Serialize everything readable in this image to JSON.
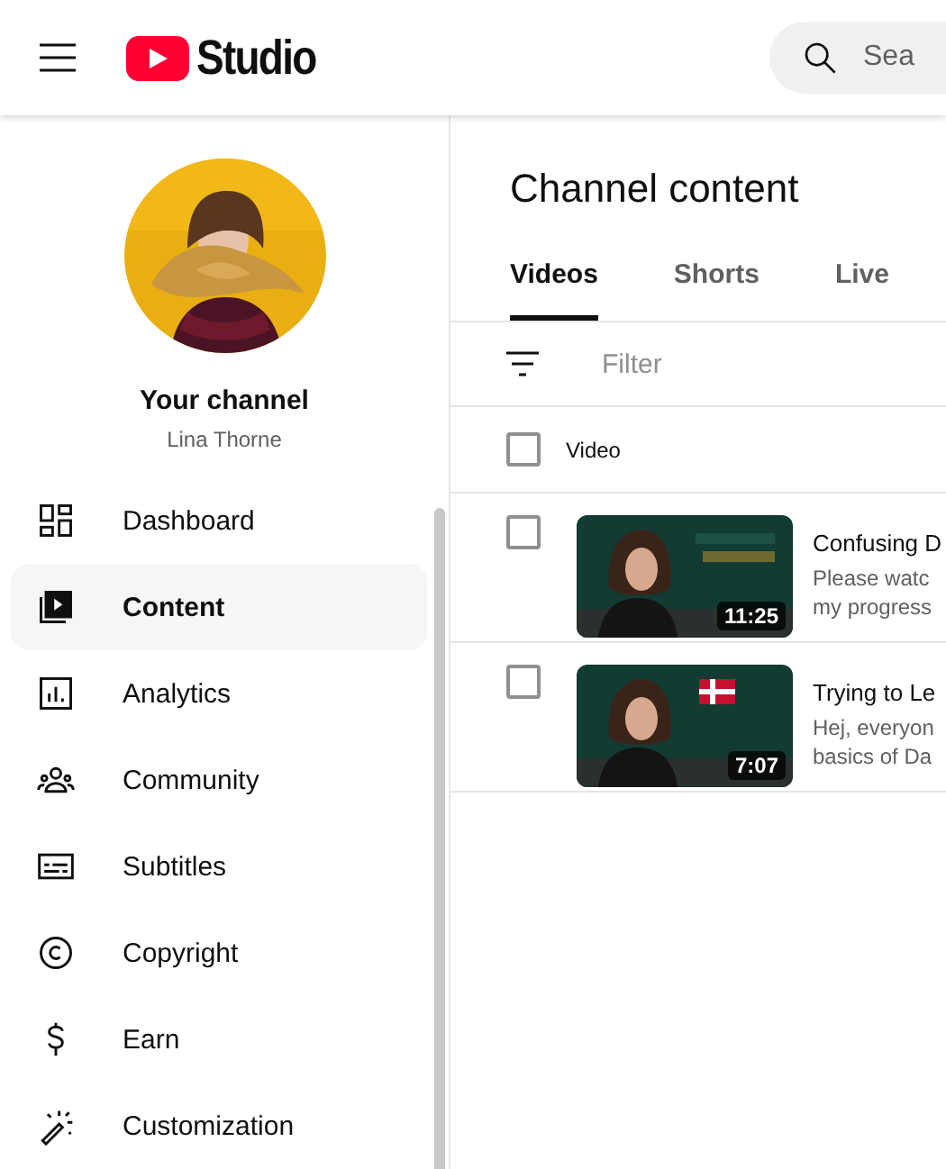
{
  "header": {
    "logo_text": "Studio",
    "search": {
      "placeholder": "Sea"
    }
  },
  "channel": {
    "title": "Your channel",
    "name": "Lina Thorne"
  },
  "nav": [
    {
      "label": "Dashboard",
      "kind": "dashboard",
      "selected": false
    },
    {
      "label": "Content",
      "kind": "content",
      "selected": true
    },
    {
      "label": "Analytics",
      "kind": "analytics",
      "selected": false
    },
    {
      "label": "Community",
      "kind": "community",
      "selected": false
    },
    {
      "label": "Subtitles",
      "kind": "subtitles",
      "selected": false
    },
    {
      "label": "Copyright",
      "kind": "copyright",
      "selected": false
    },
    {
      "label": "Earn",
      "kind": "earn",
      "selected": false
    },
    {
      "label": "Customization",
      "kind": "customization",
      "selected": false
    }
  ],
  "content": {
    "title": "Channel content",
    "tabs": [
      {
        "label": "Videos",
        "selected": true
      },
      {
        "label": "Shorts",
        "selected": false
      },
      {
        "label": "Live",
        "selected": false
      }
    ],
    "filter": {
      "placeholder": "Filter"
    },
    "select_all": {
      "checked": false
    },
    "columns": [
      "Video"
    ],
    "videos": [
      {
        "title": "Confusing D",
        "description": "Please watc\nmy progress",
        "duration": "11:25",
        "checked": false,
        "kind": "numbers"
      },
      {
        "title": "Trying to Le",
        "description": "Hej, everyon\nbasics of Da",
        "duration": "7:07",
        "checked": false,
        "kind": "flag"
      }
    ]
  }
}
